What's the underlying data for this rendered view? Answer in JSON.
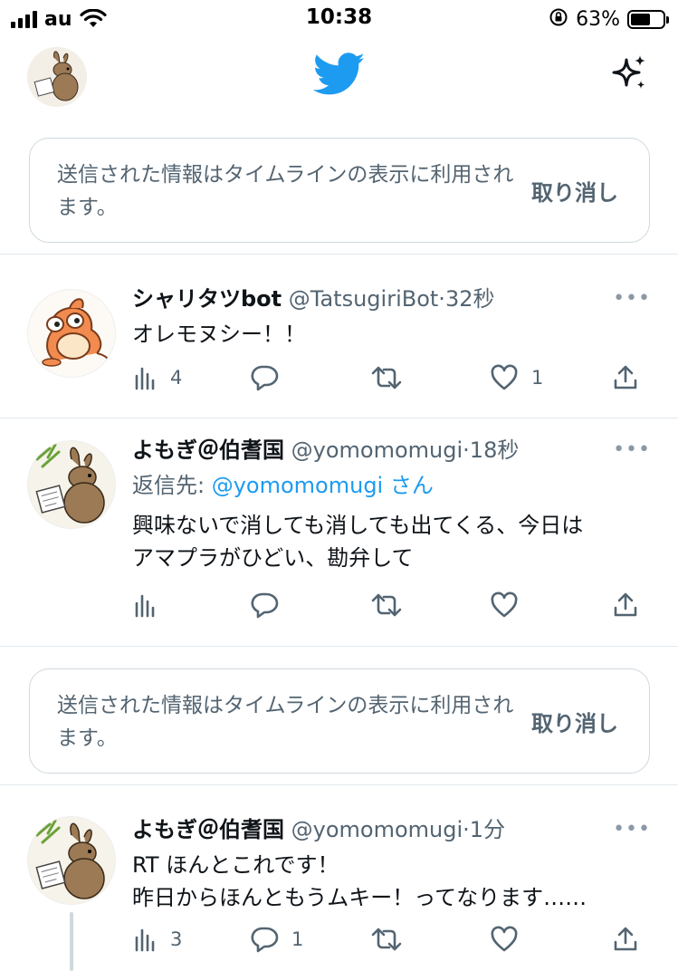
{
  "status_bar": {
    "carrier": "au",
    "time": "10:38",
    "battery_percent": "63%",
    "battery_level": 0.63
  },
  "top_nav": {
    "logo_icon": "bird-logo-icon",
    "brand_color": "#1d9bf0",
    "sparkle_icon": "sparkle-icon"
  },
  "notices": [
    {
      "text": "送信された情報はタイムラインの表示に利用されます。",
      "action": "取り消し"
    },
    {
      "text": "送信された情報はタイムラインの表示に利用されます。",
      "action": "取り消し"
    }
  ],
  "tweets": [
    {
      "name": "シャリタツbot",
      "handle": "@TatsugiriBot",
      "time": "32秒",
      "reply_prefix": "",
      "reply_mention": "",
      "reply_suffix": "",
      "lines": [
        "オレモヌシー！！"
      ],
      "views": "4",
      "replies": "",
      "retweets": "",
      "likes": "1"
    },
    {
      "name": "よもぎ＠伯耆国",
      "handle": "@yomomomugi",
      "time": "18秒",
      "reply_prefix": "返信先: ",
      "reply_mention": "@yomomomugi",
      "reply_suffix": "さん",
      "lines": [
        "興味ないで消しても消しても出てくる、今日は",
        "アマプラがひどい、勘弁して"
      ],
      "views": "",
      "replies": "",
      "retweets": "",
      "likes": ""
    },
    {
      "name": "よもぎ＠伯耆国",
      "handle": "@yomomomugi",
      "time": "1分",
      "reply_prefix": "",
      "reply_mention": "",
      "reply_suffix": "",
      "lines": [
        "RT ほんとこれです！",
        "昨日からほんともうムキー！ってなります……"
      ],
      "views": "3",
      "replies": "1",
      "retweets": "",
      "likes": ""
    }
  ],
  "separator": "·",
  "more_glyph": "•••"
}
